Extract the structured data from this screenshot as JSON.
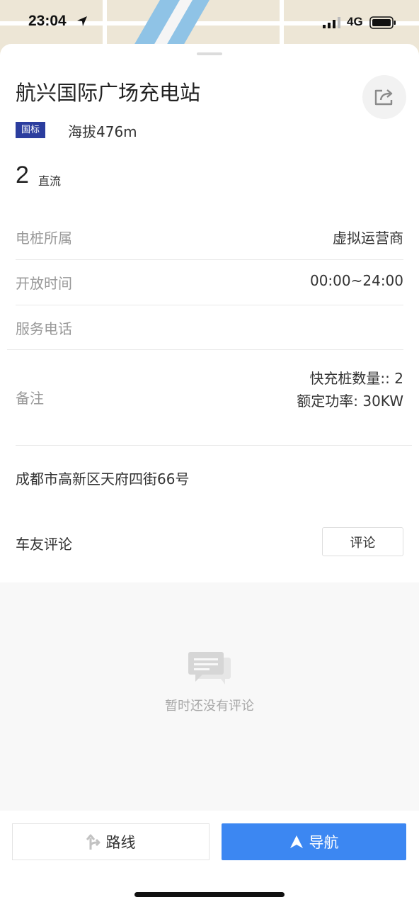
{
  "status_bar": {
    "time": "23:04",
    "network": "4G"
  },
  "station": {
    "title": "航兴国际广场充电站",
    "badge": "国标",
    "altitude": "海拔476m",
    "dc_count": "2",
    "dc_label": "直流"
  },
  "details": [
    {
      "label": "电桩所属",
      "value": "虚拟运营商"
    },
    {
      "label": "开放时间",
      "value": "00:00~24:00"
    },
    {
      "label": "服务电话",
      "value": ""
    },
    {
      "label": "备注",
      "value_line1": "快充桩数量:: 2",
      "value_line2": "额定功率: 30KW"
    }
  ],
  "address": "成都市高新区天府四街66号",
  "reviews": {
    "title": "车友评论",
    "button_label": "评论",
    "empty_text": "暂时还没有评论"
  },
  "actions": {
    "route_label": "路线",
    "navigate_label": "导航"
  },
  "colors": {
    "badge": "#2b3d9e",
    "navigate_button": "#3c87f2"
  }
}
